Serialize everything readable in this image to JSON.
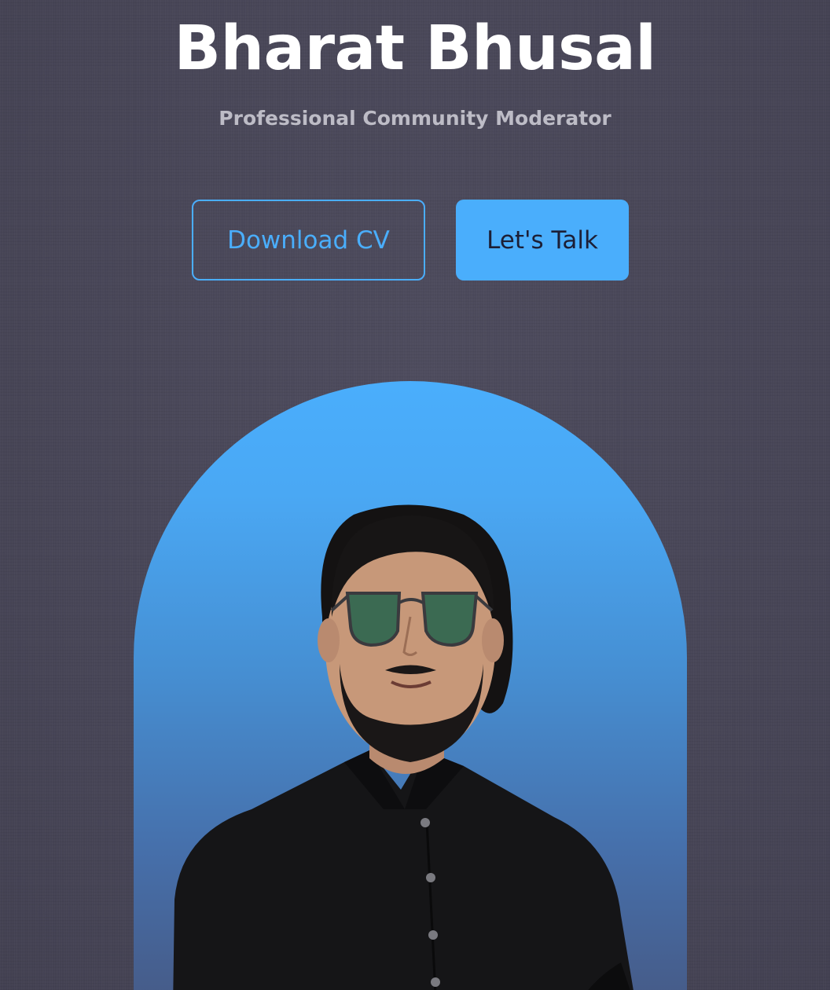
{
  "hero": {
    "name": "Bharat Bhusal",
    "subtitle": "Professional Community Moderator"
  },
  "actions": {
    "download_label": "Download CV",
    "talk_label": "Let's Talk"
  },
  "colors": {
    "accent": "#4aaefc",
    "background": "#4a4859",
    "name_text": "#ffffff",
    "subtitle_text": "#bdbcc6",
    "solid_button_text": "#1c1f36"
  },
  "portrait": {
    "icon": "person-portrait-icon"
  }
}
